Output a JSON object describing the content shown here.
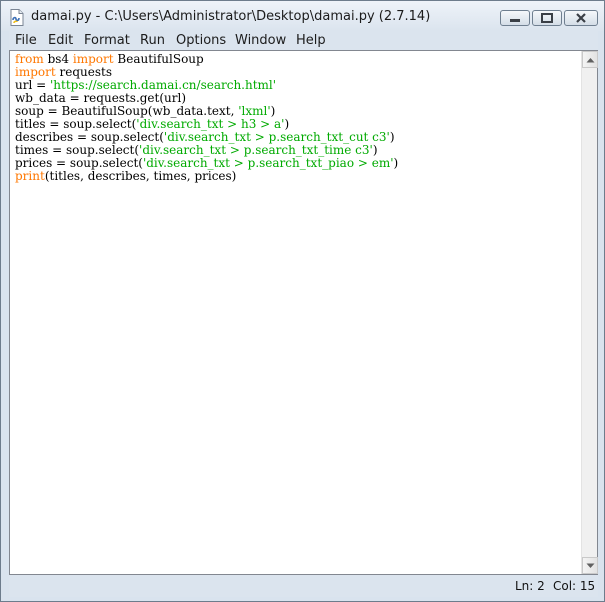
{
  "window": {
    "title": "damai.py - C:\\Users\\Administrator\\Desktop\\damai.py (2.7.14)",
    "icon": "python-file-icon"
  },
  "title_buttons": {
    "minimize_icon": "minimize-icon",
    "maximize_icon": "maximize-icon",
    "close_icon": "close-icon"
  },
  "menu": {
    "items": [
      "File",
      "Edit",
      "Format",
      "Run",
      "Options",
      "Window",
      "Help"
    ]
  },
  "editor": {
    "lines": [
      [
        {
          "t": "from",
          "c": "kw"
        },
        {
          "t": " bs4 "
        },
        {
          "t": "import",
          "c": "kw"
        },
        {
          "t": " BeautifulSoup"
        }
      ],
      [
        {
          "t": "import",
          "c": "kw"
        },
        {
          "t": " requests"
        }
      ],
      [
        {
          "t": "url = "
        },
        {
          "t": "'https://search.damai.cn/search.html'",
          "c": "str"
        }
      ],
      [
        {
          "t": "wb_data = requests.get(url)"
        }
      ],
      [
        {
          "t": "soup = BeautifulSoup(wb_data.text, "
        },
        {
          "t": "'lxml'",
          "c": "str"
        },
        {
          "t": ")"
        }
      ],
      [
        {
          "t": "titles = soup.select("
        },
        {
          "t": "'div.search_txt > h3 > a'",
          "c": "str"
        },
        {
          "t": ")"
        }
      ],
      [
        {
          "t": "describes = soup.select("
        },
        {
          "t": "'div.search_txt > p.search_txt_cut c3'",
          "c": "str"
        },
        {
          "t": ")"
        }
      ],
      [
        {
          "t": "times = soup.select("
        },
        {
          "t": "'div.search_txt > p.search_txt_time c3'",
          "c": "str"
        },
        {
          "t": ")"
        }
      ],
      [
        {
          "t": "prices = soup.select("
        },
        {
          "t": "'div.search_txt > p.search_txt_piao > em'",
          "c": "str"
        },
        {
          "t": ")"
        }
      ],
      [
        {
          "t": "print",
          "c": "kw"
        },
        {
          "t": "(titles, describes, times, prices)"
        }
      ]
    ],
    "colors": {
      "keyword": "#ff7700",
      "string": "#00aa00",
      "default": "#000000"
    }
  },
  "scrollbar": {
    "up_icon": "scroll-up-arrow-icon",
    "down_icon": "scroll-down-arrow-icon"
  },
  "status": {
    "line": "Ln: 2",
    "col": "Col: 15"
  }
}
